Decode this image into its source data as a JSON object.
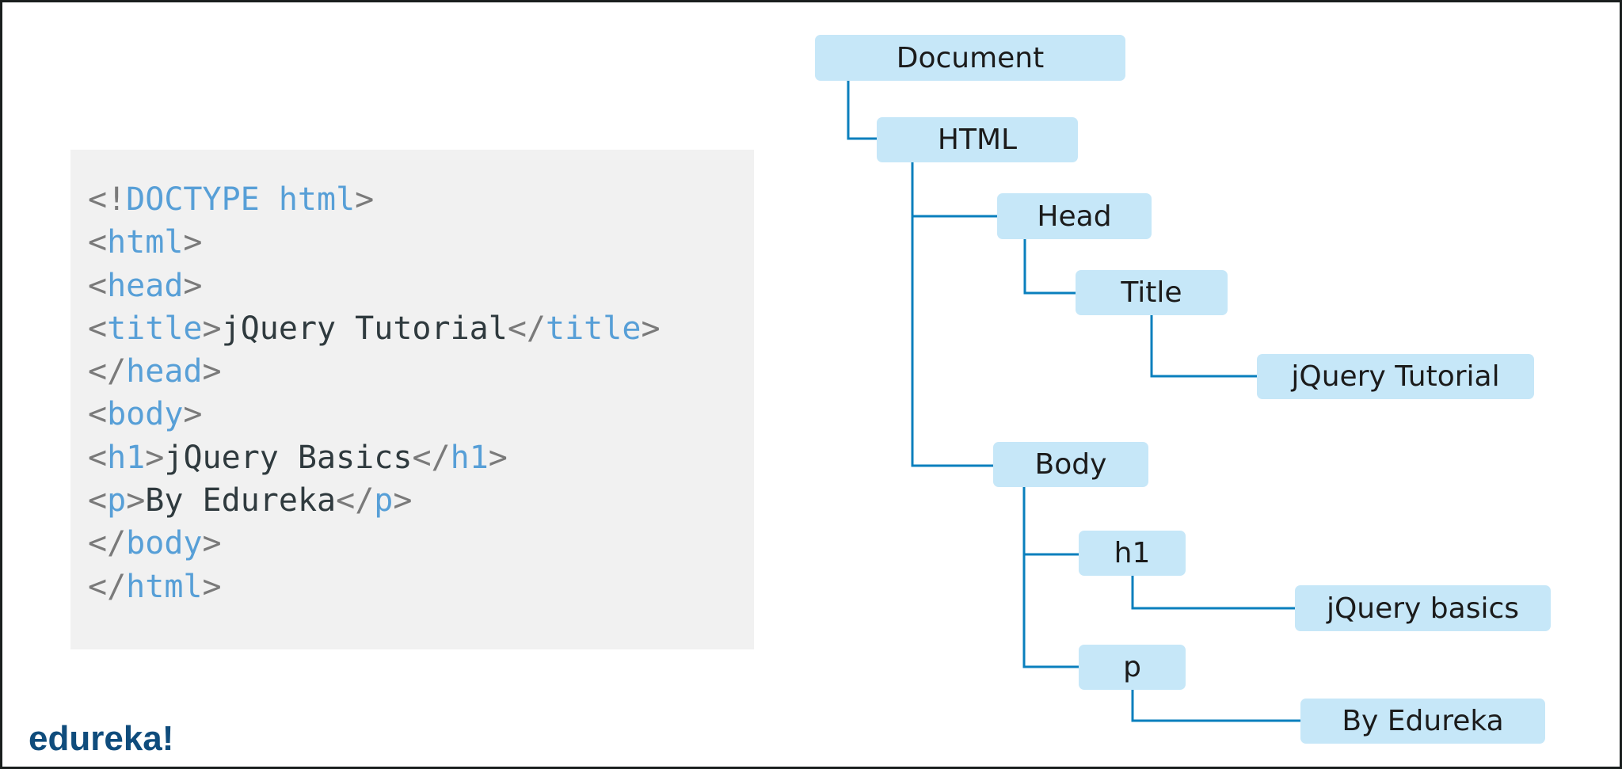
{
  "code": {
    "lines": [
      [
        [
          "p",
          "<!"
        ],
        [
          "t",
          "DOCTYPE html"
        ],
        [
          "p",
          ">"
        ]
      ],
      [
        [
          "p",
          "<"
        ],
        [
          "t",
          "html"
        ],
        [
          "p",
          ">"
        ]
      ],
      [
        [
          "p",
          "<"
        ],
        [
          "t",
          "head"
        ],
        [
          "p",
          ">"
        ]
      ],
      [
        [
          "p",
          "<"
        ],
        [
          "t",
          "title"
        ],
        [
          "p",
          ">"
        ],
        [
          "x",
          "jQuery Tutorial"
        ],
        [
          "p",
          "</"
        ],
        [
          "t",
          "title"
        ],
        [
          "p",
          ">"
        ]
      ],
      [
        [
          "p",
          "</"
        ],
        [
          "t",
          "head"
        ],
        [
          "p",
          ">"
        ]
      ],
      [
        [
          "p",
          "<"
        ],
        [
          "t",
          "body"
        ],
        [
          "p",
          ">"
        ]
      ],
      [
        [
          "p",
          "<"
        ],
        [
          "t",
          "h1"
        ],
        [
          "p",
          ">"
        ],
        [
          "x",
          "jQuery Basics"
        ],
        [
          "p",
          "</"
        ],
        [
          "t",
          "h1"
        ],
        [
          "p",
          ">"
        ]
      ],
      [
        [
          "p",
          "<"
        ],
        [
          "t",
          "p"
        ],
        [
          "p",
          ">"
        ],
        [
          "x",
          "By Edureka"
        ],
        [
          "p",
          "</"
        ],
        [
          "t",
          "p"
        ],
        [
          "p",
          ">"
        ]
      ],
      [
        [
          "p",
          "</"
        ],
        [
          "t",
          "body"
        ],
        [
          "p",
          ">"
        ]
      ],
      [
        [
          "p",
          "</"
        ],
        [
          "t",
          "html"
        ],
        [
          "p",
          ">"
        ]
      ]
    ]
  },
  "tree": {
    "document": "Document",
    "html": "HTML",
    "head": "Head",
    "title": "Title",
    "title_text": "jQuery Tutorial",
    "body": "Body",
    "h1": "h1",
    "h1_text": "jQuery basics",
    "p": "p",
    "p_text": "By Edureka"
  },
  "logo": "edureka!",
  "colors": {
    "node_fill": "#c6e7f8",
    "connector": "#0a7fbd",
    "tag": "#579fd7",
    "bracket": "#7a7a7a",
    "text": "#2f3a3e",
    "logo": "#0f4c7c"
  }
}
